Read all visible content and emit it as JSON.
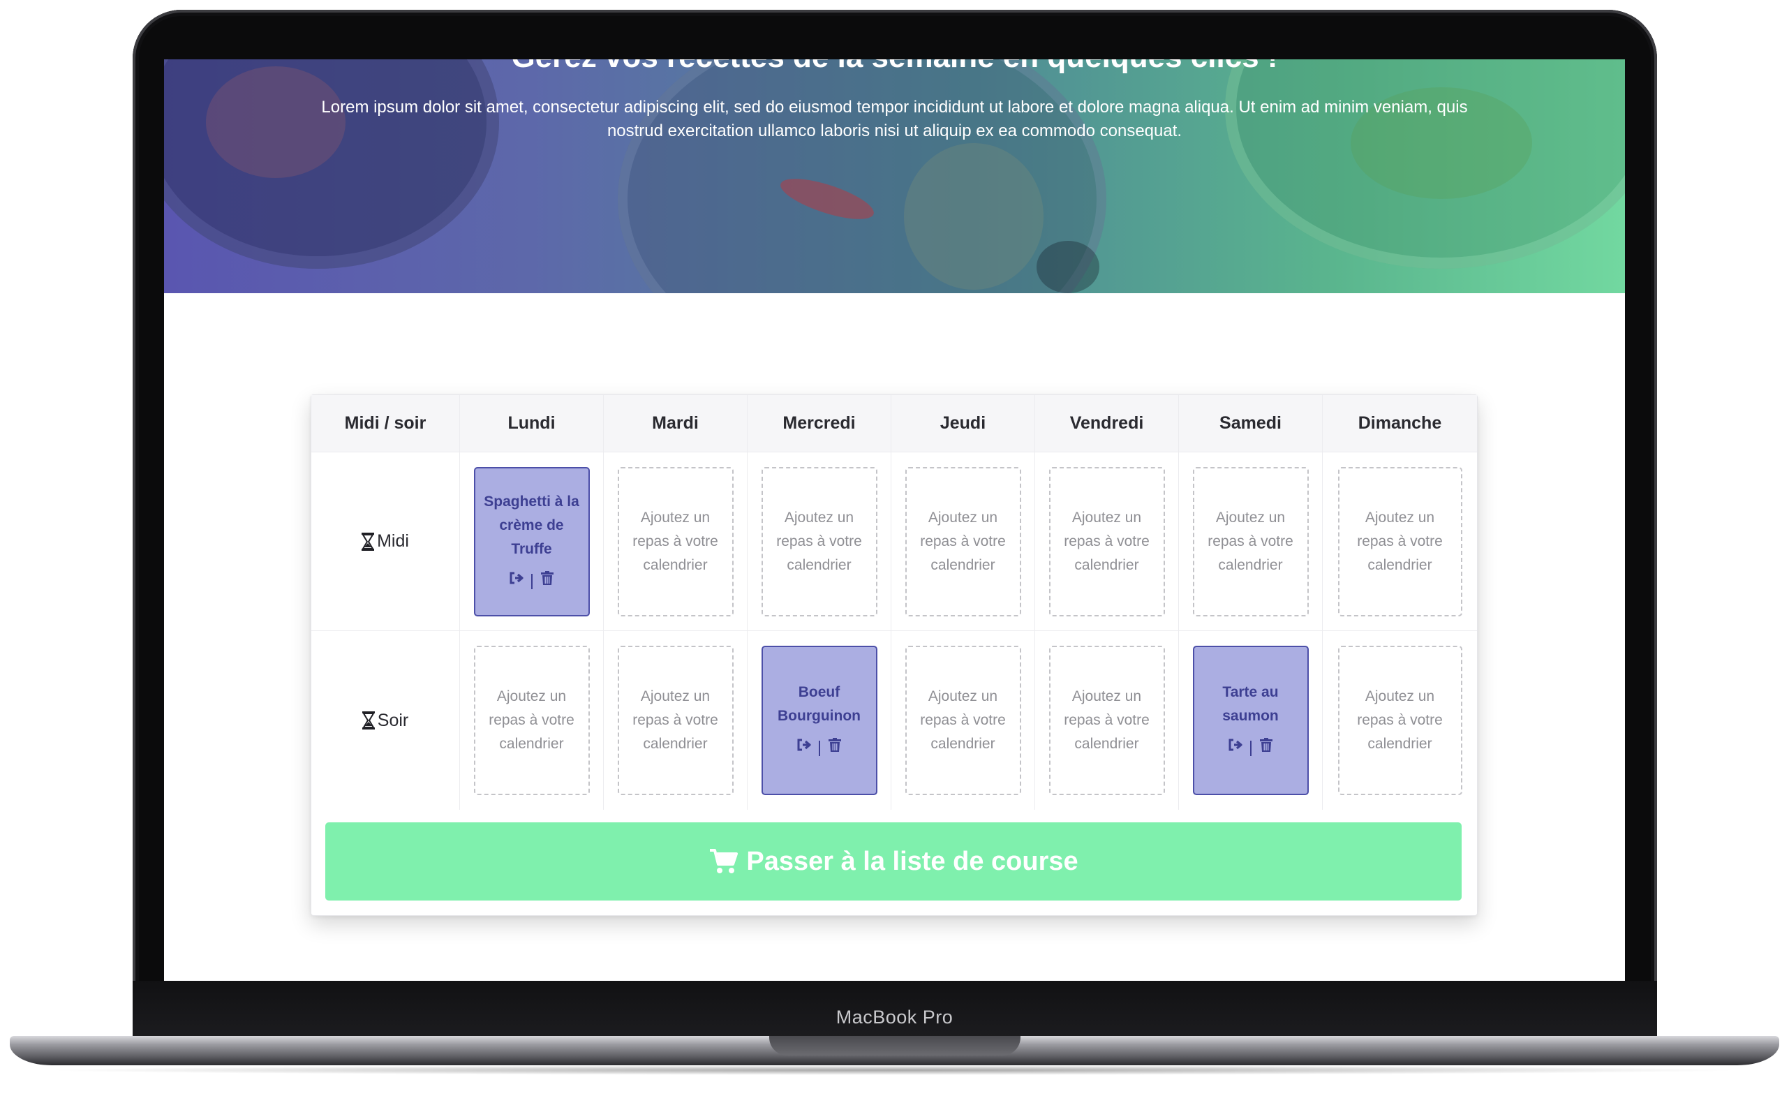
{
  "hero": {
    "title": "Gérez vos recettes de la semaine en quelques clics !",
    "text": "Lorem ipsum dolor sit amet, consectetur adipiscing elit, sed do eiusmod tempor incididunt ut labore et dolore magna aliqua. Ut enim ad minim veniam, quis nostrud exercitation ullamco laboris nisi ut aliquip ex ea commodo consequat."
  },
  "planner": {
    "header": [
      "Midi / soir",
      "Lundi",
      "Mardi",
      "Mercredi",
      "Jeudi",
      "Vendredi",
      "Samedi",
      "Dimanche"
    ],
    "empty_slot_text": "Ajoutez un repas à votre calendrier",
    "rows": [
      {
        "period": "Midi",
        "slots": [
          "Spaghetti à la crème de Truffe",
          "",
          "",
          "",
          "",
          "",
          ""
        ]
      },
      {
        "period": "Soir",
        "slots": [
          "",
          "",
          "Boeuf Bourguinon",
          "",
          "",
          "Tarte au saumon",
          ""
        ]
      }
    ],
    "colors": {
      "filled_bg": "#abaee2",
      "filled_border": "#4c4fa8",
      "cta_bg": "#7ff0ad"
    },
    "icons": {
      "period": "hourglass-icon",
      "move": "sign-out-icon",
      "delete": "trash-icon",
      "cta": "shopping-cart-icon"
    }
  },
  "cta": {
    "label": "Passer à la liste de course"
  },
  "device": {
    "brand": "MacBook Pro"
  }
}
